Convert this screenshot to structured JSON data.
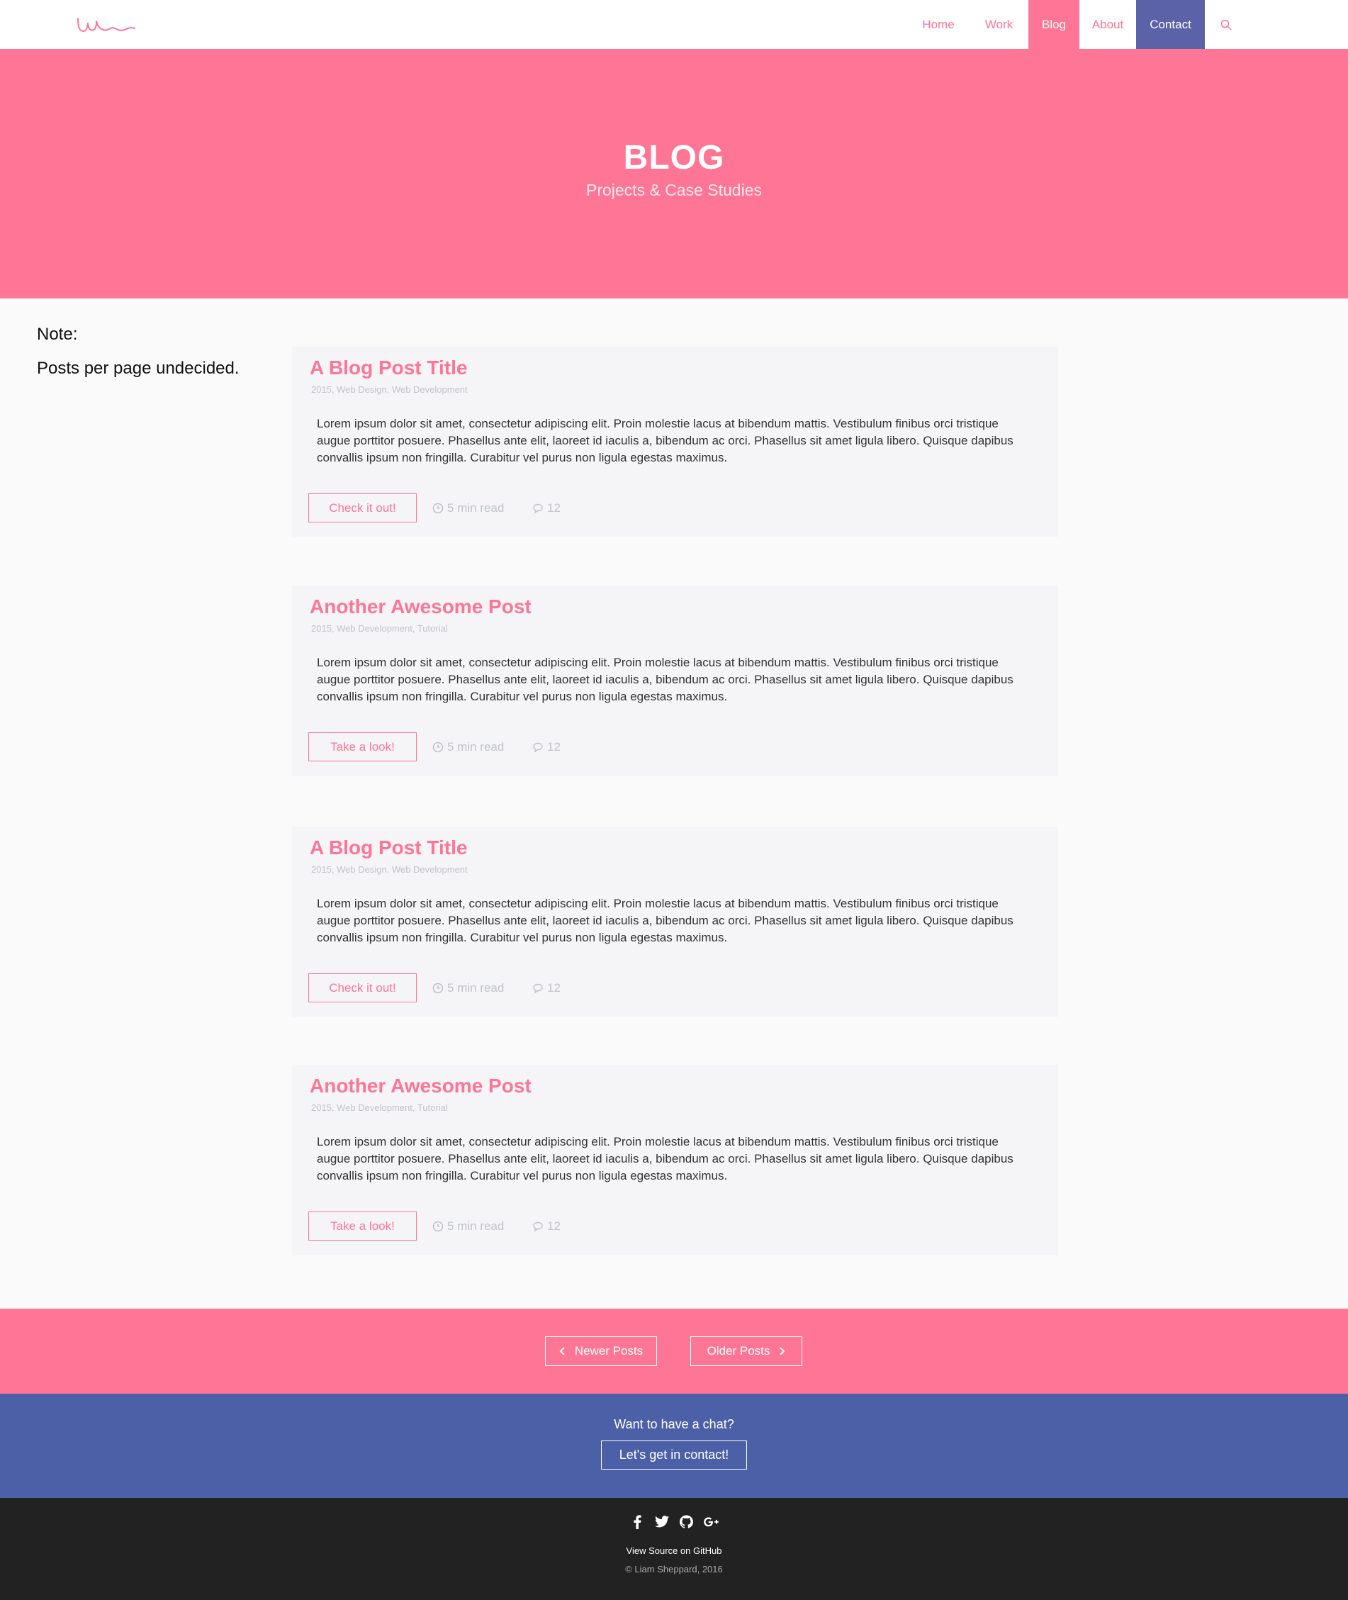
{
  "nav": {
    "items": [
      {
        "label": "Home"
      },
      {
        "label": "Work"
      },
      {
        "label": "Blog"
      },
      {
        "label": "About"
      },
      {
        "label": "Contact"
      }
    ],
    "search_icon": "search-icon",
    "colors": {
      "accent": "#ff7595",
      "contact_bg": "#5b62a8"
    }
  },
  "hero": {
    "title": "BLOG",
    "subtitle": "Projects & Case Studies"
  },
  "note": {
    "heading": "Note:",
    "text": "Posts per page undecided."
  },
  "posts": [
    {
      "title": "A Blog Post Title",
      "meta": "2015, Web Design, Web Development",
      "body": "Lorem ipsum dolor sit amet, consectetur adipiscing elit. Proin molestie lacus at bibendum mattis. Vestibulum finibus orci tristique augue porttitor posuere. Phasellus ante elit, laoreet id iaculis a, bibendum ac orci. Phasellus sit amet ligula libero. Quisque dapibus convallis ipsum non fringilla. Curabitur vel purus non ligula egestas maximus.",
      "button": "Check it out!",
      "read_time": "5 min read",
      "comments": "12"
    },
    {
      "title": "Another Awesome Post",
      "meta": "2015, Web Development, Tutorial",
      "body": "Lorem ipsum dolor sit amet, consectetur adipiscing elit. Proin molestie lacus at bibendum mattis. Vestibulum finibus orci tristique augue porttitor posuere. Phasellus ante elit, laoreet id iaculis a, bibendum ac orci. Phasellus sit amet ligula libero. Quisque dapibus convallis ipsum non fringilla. Curabitur vel purus non ligula egestas maximus.",
      "button": "Take a look!",
      "read_time": "5 min read",
      "comments": "12"
    },
    {
      "title": "A Blog Post Title",
      "meta": "2015, Web Design, Web Development",
      "body": "Lorem ipsum dolor sit amet, consectetur adipiscing elit. Proin molestie lacus at bibendum mattis. Vestibulum finibus orci tristique augue porttitor posuere. Phasellus ante elit, laoreet id iaculis a, bibendum ac orci. Phasellus sit amet ligula libero. Quisque dapibus convallis ipsum non fringilla. Curabitur vel purus non ligula egestas maximus.",
      "button": "Check it out!",
      "read_time": "5 min read",
      "comments": "12"
    },
    {
      "title": "Another Awesome Post",
      "meta": "2015, Web Development, Tutorial",
      "body": "Lorem ipsum dolor sit amet, consectetur adipiscing elit. Proin molestie lacus at bibendum mattis. Vestibulum finibus orci tristique augue porttitor posuere. Phasellus ante elit, laoreet id iaculis a, bibendum ac orci. Phasellus sit amet ligula libero. Quisque dapibus convallis ipsum non fringilla. Curabitur vel purus non ligula egestas maximus.",
      "button": "Take a look!",
      "read_time": "5 min read",
      "comments": "12"
    }
  ],
  "pagination": {
    "newer": "Newer Posts",
    "older": "Older Posts"
  },
  "cta": {
    "text": "Want to have a chat?",
    "button": "Let's get in contact!"
  },
  "footer": {
    "social_icons": [
      "facebook-icon",
      "twitter-icon",
      "github-icon",
      "google-plus-icon"
    ],
    "source_link": "View Source on GitHub",
    "copyright": "© Liam Sheppard, 2016"
  }
}
